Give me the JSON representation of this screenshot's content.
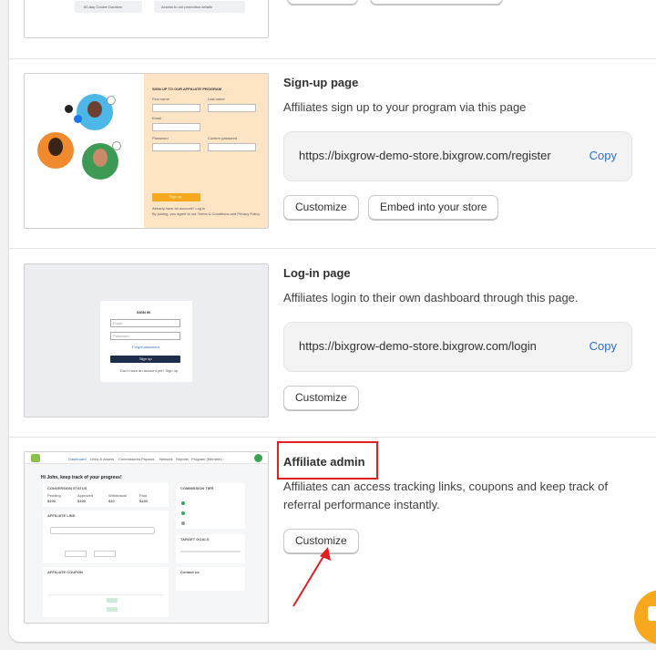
{
  "top_thumb": {
    "items": [
      "60-day Cookie Duration",
      "Access to our promotion details"
    ]
  },
  "signup": {
    "title": "Sign-up page",
    "description": "Affiliates sign up to your program via this page",
    "url": "https://bixgrow-demo-store.bixgrow.com/register",
    "copy_label": "Copy",
    "customize_label": "Customize",
    "embed_label": "Embed into your store",
    "thumb": {
      "heading": "SIGN UP TO OUR AFFILIATE PROGRAM",
      "first_name": "First name",
      "last_name": "Last name",
      "email": "Email",
      "password": "Password",
      "confirm_password": "Confirm password",
      "signup_button": "Sign up",
      "login_note": "Already have an account? Log in",
      "terms_note": "By joining, you agree to our Terms & Conditions and Privacy Policy"
    }
  },
  "login": {
    "title": "Log-in page",
    "description": "Affiliates login to their own dashboard through this page.",
    "url": "https://bixgrow-demo-store.bixgrow.com/login",
    "copy_label": "Copy",
    "customize_label": "Customize",
    "thumb": {
      "heading": "SIGN IN",
      "email": "Email",
      "password": "Password",
      "forgot": "Forgot password",
      "button": "Sign up",
      "no_account": "Don't have an account yet? Sign up"
    }
  },
  "admin": {
    "title": "Affiliate admin",
    "description": "Affiliates can access tracking links, coupons and keep track of referral performance instantly.",
    "customize_label": "Customize",
    "thumb": {
      "nav": [
        "Dashboard",
        "Links & Assets",
        "Commissions",
        "Payouts",
        "Network",
        "Reports",
        "Program (Member)"
      ],
      "greeting": "Hi John, keep track of your progress!",
      "conversion_heading": "CONVERSION STATUS",
      "stats_labels": [
        "Pending",
        "Approved",
        "Withdrawal",
        "Paid"
      ],
      "stats_values": [
        "$100",
        "$100",
        "$10",
        "$100"
      ],
      "commission_heading": "COMMISSION TIER",
      "affiliate_link_heading": "AFFILIATE LINK",
      "affiliate_coupon_heading": "AFFILIATE COUPON",
      "target_heading": "TARGET GOALS",
      "contact_heading": "Contact us"
    }
  },
  "chat_icon": "chat-icon"
}
